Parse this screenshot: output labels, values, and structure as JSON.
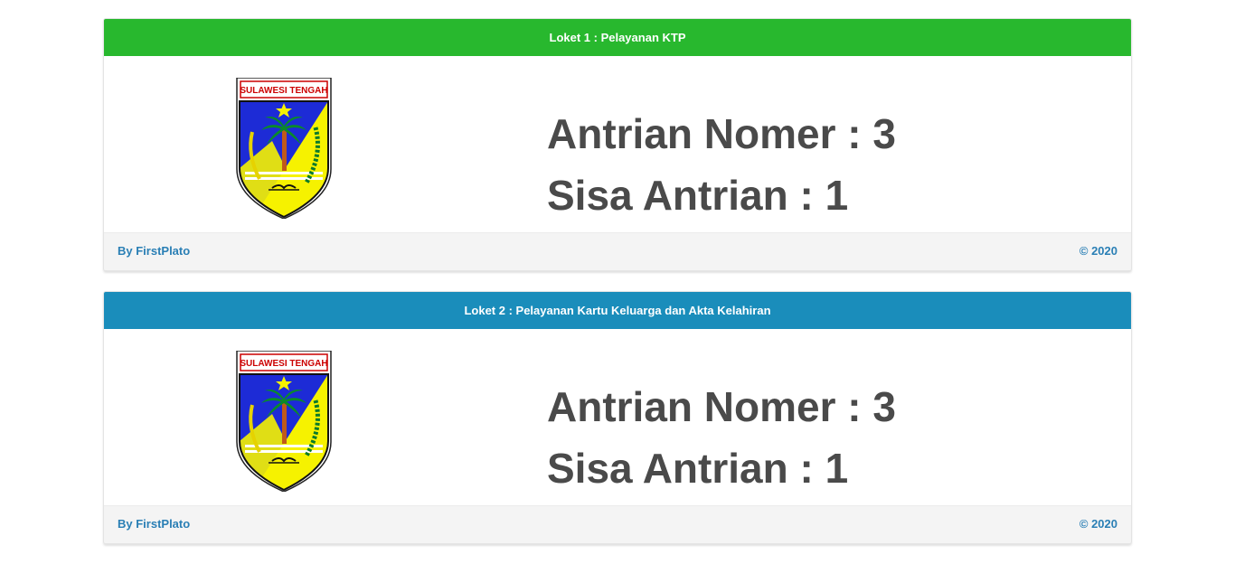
{
  "colors": {
    "counter1_header": "#28b82e",
    "counter2_header": "#1a8dbb",
    "stat_text": "#4a4a4a",
    "footer_text": "#2a7fb5"
  },
  "counters": [
    {
      "title": "Loket 1 : Pelayanan KTP",
      "emblem_label": "SULAWESI TENGAH",
      "emblem_icon": "sulawesi-tengah-emblem-icon",
      "queue_number_label": "Antrian Nomer : ",
      "queue_number_value": "3",
      "remaining_label": "Sisa Antrian : ",
      "remaining_value": "1",
      "footer_left": "By FirstPlato",
      "footer_right": "© 2020"
    },
    {
      "title": "Loket 2 : Pelayanan Kartu Keluarga dan Akta Kelahiran",
      "emblem_label": "SULAWESI TENGAH",
      "emblem_icon": "sulawesi-tengah-emblem-icon",
      "queue_number_label": "Antrian Nomer : ",
      "queue_number_value": "3",
      "remaining_label": "Sisa Antrian : ",
      "remaining_value": "1",
      "footer_left": "By FirstPlato",
      "footer_right": "© 2020"
    }
  ]
}
